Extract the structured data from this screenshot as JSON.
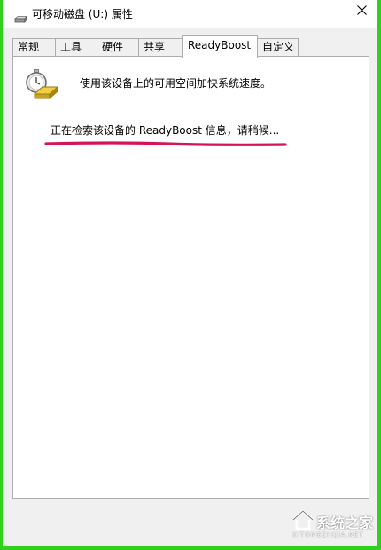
{
  "window": {
    "title": "可移动磁盘 (U:) 属性"
  },
  "tabs": [
    {
      "label": "常规",
      "active": false
    },
    {
      "label": "工具",
      "active": false
    },
    {
      "label": "硬件",
      "active": false
    },
    {
      "label": "共享",
      "active": false
    },
    {
      "label": "ReadyBoost",
      "active": true
    },
    {
      "label": "自定义",
      "active": false
    }
  ],
  "readyboost": {
    "icon": "stopwatch-drive-icon",
    "description": "使用该设备上的可用空间加快系统速度。",
    "status": "正在检索该设备的 ReadyBoost 信息，请稍候...",
    "annotation_color": "#d4145a"
  },
  "watermark": {
    "brand": "系统之家",
    "sub": "XITONGZHIJIA.NET"
  },
  "colors": {
    "frame": "#2fd11c",
    "window_bg": "#f0f0f0",
    "panel_bg": "#ffffff",
    "border": "#adadad"
  }
}
